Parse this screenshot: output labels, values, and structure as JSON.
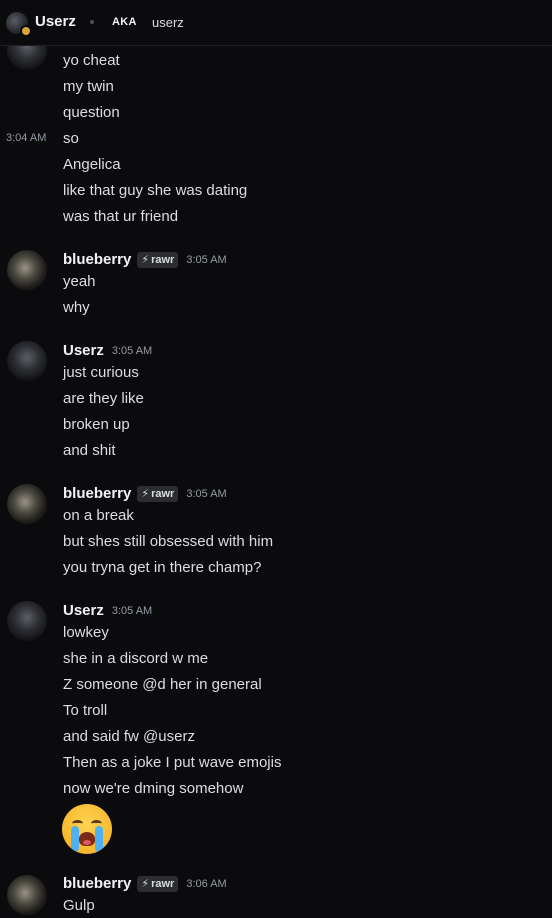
{
  "header": {
    "title": "Userz",
    "aka_label": "AKA",
    "aka_name": "userz",
    "status_color": "#d9a33b"
  },
  "messages": {
    "continued": [
      "yo cheat",
      "my twin",
      "question",
      "so",
      "Angelica",
      "like that guy she was dating",
      "was that ur friend"
    ],
    "continued_timestamp": "3:04 AM",
    "group1": {
      "author": "blueberry",
      "tag": "rawr",
      "timestamp": "3:05 AM",
      "lines": [
        "yeah",
        "why"
      ]
    },
    "group2": {
      "author": "Userz",
      "timestamp": "3:05 AM",
      "lines": [
        "just curious",
        "are they like",
        "broken up",
        "and shit"
      ]
    },
    "group3": {
      "author": "blueberry",
      "tag": "rawr",
      "timestamp": "3:05 AM",
      "lines": [
        "on a break",
        "but shes still obsessed with him",
        "you tryna get in there champ?"
      ]
    },
    "group4": {
      "author": "Userz",
      "timestamp": "3:05 AM",
      "lines": [
        "lowkey",
        "she in a discord w me",
        "Z someone @d her in general",
        "To troll",
        "and said fw @userz",
        "Then as a joke I put wave emojis",
        "now we're dming somehow"
      ],
      "emoji": "loudly-crying-face"
    },
    "group5": {
      "author": "blueberry",
      "tag": "rawr",
      "timestamp": "3:06 AM",
      "lines": [
        "Gulp"
      ]
    }
  },
  "icons": {
    "tag_icon": "lightning-icon"
  },
  "colors": {
    "background": "#0b0b0e",
    "text": "#dbdee1",
    "timestamp": "#949ba4",
    "author": "#f2f3f5"
  }
}
